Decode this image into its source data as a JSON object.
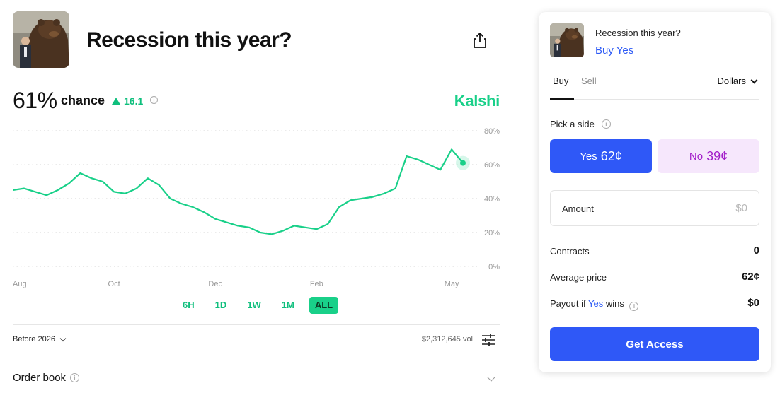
{
  "market": {
    "title": "Recession this year?",
    "probability": "61%",
    "chance_label": "chance",
    "change": "16.1",
    "brand": "Kalshi"
  },
  "colors": {
    "accent_green": "#19d089",
    "primary_blue": "#2f58f7",
    "no_purple": "#a21dc9",
    "no_bg": "#f6e7fc"
  },
  "icons": {
    "share": "share-icon",
    "info": "info-icon",
    "settings": "sliders-icon",
    "chevron": "chevron-down-icon",
    "bear": "bear-statue-image"
  },
  "chart_data": {
    "type": "line",
    "x": [
      "Aug",
      "Aug",
      "Aug",
      "Aug",
      "Sep",
      "Sep",
      "Sep",
      "Sep",
      "Sep",
      "Oct",
      "Oct",
      "Oct",
      "Oct",
      "Oct",
      "Nov",
      "Nov",
      "Nov",
      "Nov",
      "Dec",
      "Dec",
      "Dec",
      "Dec",
      "Dec",
      "Jan",
      "Jan",
      "Jan",
      "Jan",
      "Feb",
      "Feb",
      "Feb",
      "Feb",
      "Mar",
      "Mar",
      "Mar",
      "Mar",
      "Apr",
      "Apr",
      "Apr",
      "Apr",
      "May",
      "May"
    ],
    "x_ticks": [
      "Aug",
      "Oct",
      "Dec",
      "Feb",
      "May"
    ],
    "series": [
      {
        "values": [
          45,
          46,
          44,
          42,
          45,
          49,
          55,
          52,
          50,
          44,
          43,
          46,
          52,
          48,
          40,
          37,
          35,
          32,
          28,
          26,
          24,
          23,
          20,
          19,
          21,
          24,
          23,
          22,
          25,
          35,
          39,
          40,
          41,
          43,
          46,
          65,
          63,
          60,
          57,
          69,
          61
        ]
      }
    ],
    "y_ticks": [
      "80%",
      "60%",
      "40%",
      "20%",
      "0%"
    ],
    "ylim": [
      0,
      80
    ],
    "current": 61,
    "grid": true,
    "line_color": "#19d089"
  },
  "ranges": [
    "6H",
    "1D",
    "1W",
    "1M",
    "ALL"
  ],
  "active_range": "ALL",
  "filters": {
    "period": "Before 2026",
    "volume": "$2,312,645 vol"
  },
  "orderbook_label": "Order book",
  "trade": {
    "title": "Recession this year?",
    "action": "Buy Yes",
    "tab_buy": "Buy",
    "tab_sell": "Sell",
    "currency": "Dollars",
    "pick_side": "Pick a side",
    "yes_label": "Yes",
    "yes_price": "62¢",
    "no_label": "No",
    "no_price": "39¢",
    "amount_label": "Amount",
    "amount_placeholder": "$0",
    "contracts_label": "Contracts",
    "contracts_value": "0",
    "avg_price_label": "Average price",
    "avg_price_value": "62¢",
    "payout_prefix": "Payout if",
    "payout_yes": "Yes",
    "payout_suffix": "wins",
    "payout_value": "$0",
    "cta": "Get Access"
  }
}
